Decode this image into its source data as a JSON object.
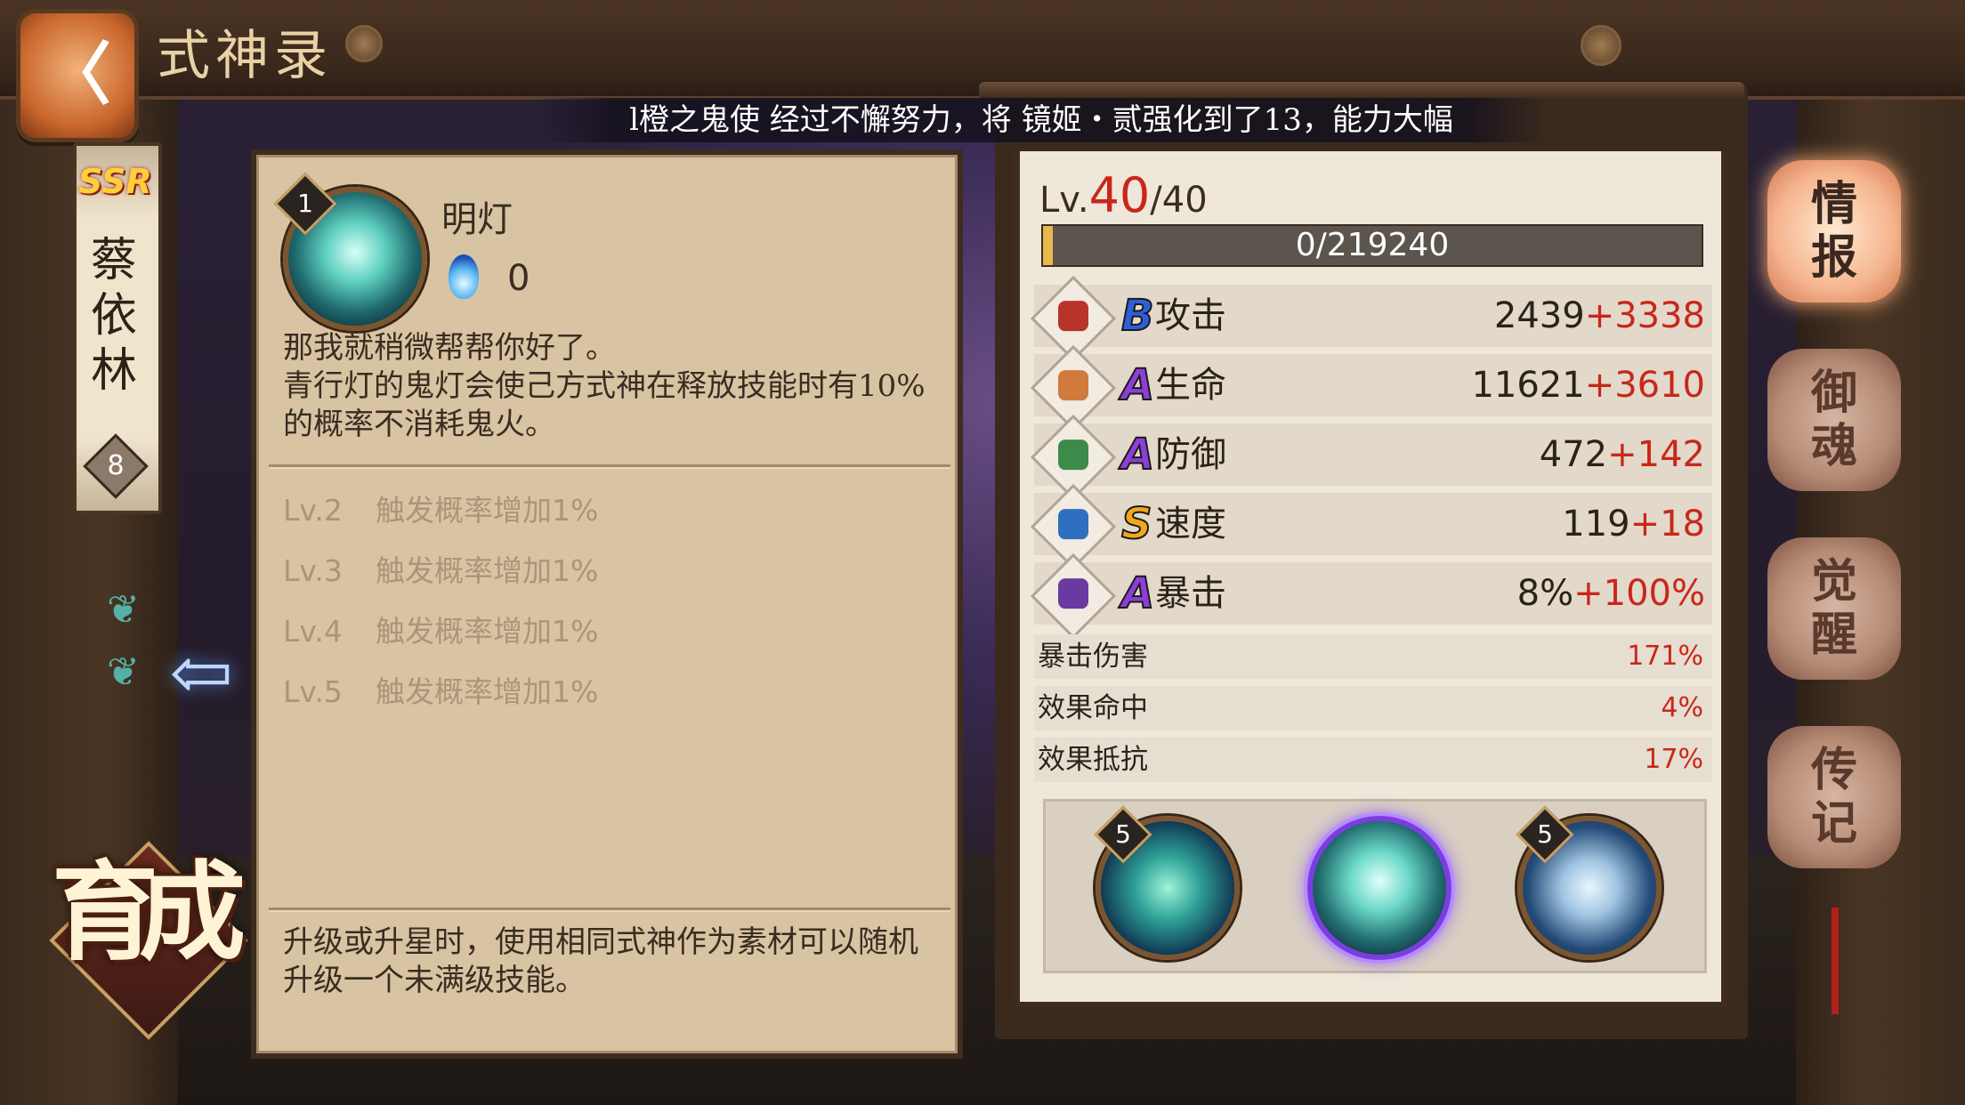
{
  "header": {
    "title": "式神录",
    "back_label": "〈"
  },
  "banner": {
    "text": "l橙之鬼使 经过不懈努力，将 镜姬・贰强化到了13，能力大幅"
  },
  "shikigami": {
    "rarity": "SSR",
    "name": "蔡依林",
    "star_badge": "8"
  },
  "nurture_label": "育成",
  "skill": {
    "level": "1",
    "name": "明灯",
    "fire_cost": "0",
    "description": "那我就稍微帮帮你好了。\n青行灯的鬼灯会使己方式神在释放技能时有10%的概率不消耗鬼火。",
    "upgrades": [
      {
        "lv": "Lv.2",
        "text": "触发概率增加1%"
      },
      {
        "lv": "Lv.3",
        "text": "触发概率增加1%"
      },
      {
        "lv": "Lv.4",
        "text": "触发概率增加1%"
      },
      {
        "lv": "Lv.5",
        "text": "触发概率增加1%"
      }
    ],
    "footer_note": "升级或升星时，使用相同式神作为素材可以随机升级一个未满级技能。"
  },
  "stats": {
    "level_prefix": "Lv.",
    "level_current": "40",
    "level_max": "/40",
    "xp_text": "0/219240",
    "xp_fraction": 0.0,
    "main": [
      {
        "grade": "B",
        "grade_color": "#2e5fd8",
        "icon": "attack-fan-icon",
        "icon_color": "#b8332a",
        "name": "攻击",
        "base": "2439",
        "bonus": "+3338"
      },
      {
        "grade": "A",
        "grade_color": "#8a3fd6",
        "icon": "hp-scroll-icon",
        "icon_color": "#d07a3e",
        "name": "生命",
        "base": "11621",
        "bonus": "+3610"
      },
      {
        "grade": "A",
        "grade_color": "#8a3fd6",
        "icon": "defense-armor-icon",
        "icon_color": "#3e8a4a",
        "name": "防御",
        "base": "472",
        "bonus": "+142"
      },
      {
        "grade": "S",
        "grade_color": "#f0a818",
        "icon": "speed-arrow-icon",
        "icon_color": "#2f6fc0",
        "name": "速度",
        "base": "119",
        "bonus": "+18"
      },
      {
        "grade": "A",
        "grade_color": "#8a3fd6",
        "icon": "crit-talisman-icon",
        "icon_color": "#6a3aa0",
        "name": "暴击",
        "base": "8%",
        "bonus": "+100%"
      }
    ],
    "sub": [
      {
        "name": "暴击伤害",
        "value": "171%"
      },
      {
        "name": "效果命中",
        "value": "4%"
      },
      {
        "name": "效果抵抗",
        "value": "17%"
      }
    ],
    "skill_slots": [
      {
        "badge": "5"
      },
      {
        "badge": ""
      },
      {
        "badge": "5"
      }
    ]
  },
  "tabs": [
    {
      "label": "情报",
      "active": true
    },
    {
      "label": "御魂",
      "active": false
    },
    {
      "label": "觉醒",
      "active": false
    },
    {
      "label": "传记",
      "active": false
    }
  ]
}
